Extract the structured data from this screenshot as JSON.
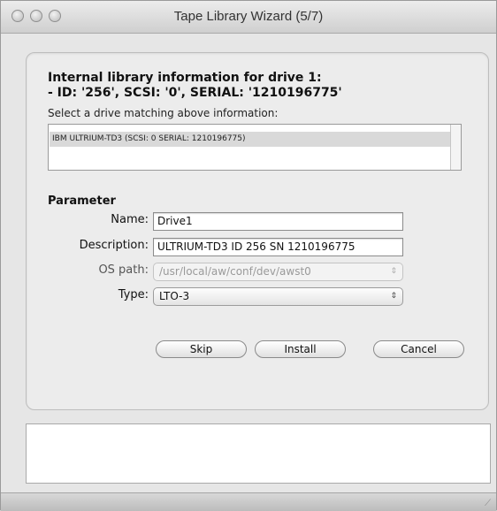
{
  "window": {
    "title": "Tape Library Wizard (5/7)"
  },
  "info": {
    "line1": "Internal library information for drive 1:",
    "line2": "- ID: '256', SCSI: '0', SERIAL: '1210196775'",
    "prompt": "Select a drive matching above information:"
  },
  "drive_list": {
    "items": [
      {
        "label": "IBM ULTRIUM-TD3 (SCSI: 0 SERIAL: 1210196775)",
        "selected": true
      }
    ]
  },
  "parameter": {
    "title": "Parameter",
    "name_label": "Name:",
    "name_value": "Drive1",
    "description_label": "Description:",
    "description_value": "ULTRIUM-TD3 ID 256 SN 1210196775",
    "os_path_label": "OS path:",
    "os_path_value": "/usr/local/aw/conf/dev/awst0",
    "os_path_enabled": false,
    "type_label": "Type:",
    "type_value": "LTO-3"
  },
  "buttons": {
    "skip": "Skip",
    "install": "Install",
    "cancel": "Cancel"
  },
  "icons": {
    "popup_arrows": "⇕"
  }
}
